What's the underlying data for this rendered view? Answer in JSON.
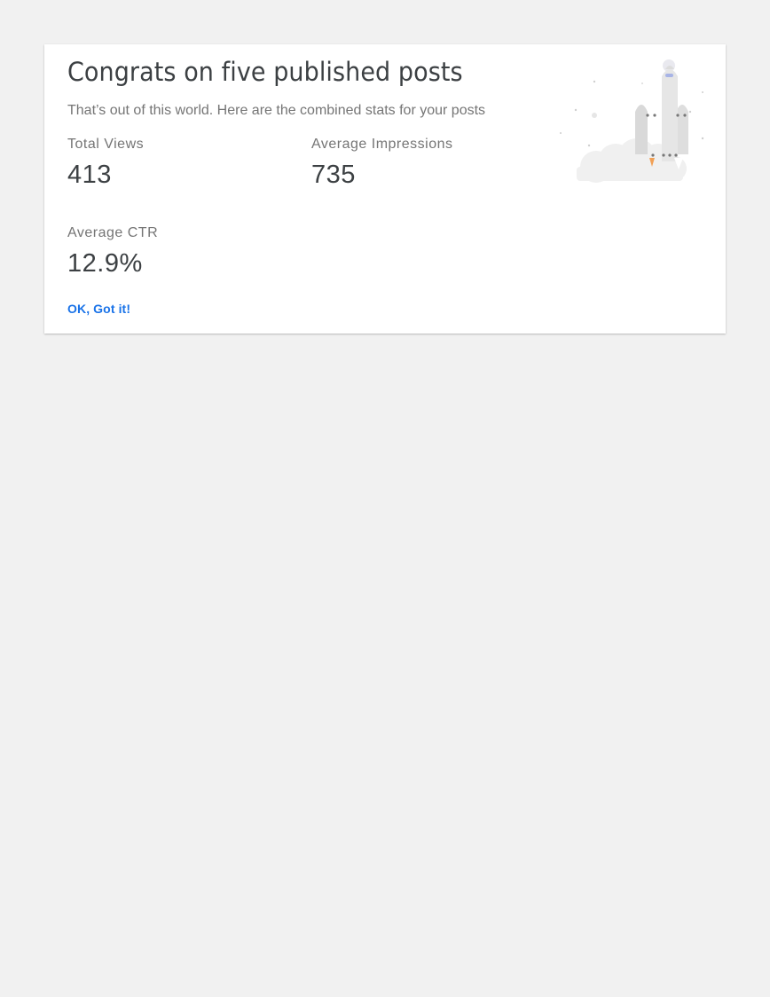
{
  "card": {
    "title": "Congrats on five published posts",
    "subtitle": "That’s out of this world. Here are the combined stats for your posts",
    "illustration_icon": "rocket-launch-icon"
  },
  "stats": {
    "total_views": {
      "label": "Total Views",
      "value": "413"
    },
    "avg_impressions": {
      "label": "Average Impressions",
      "value": "735"
    },
    "avg_ctr": {
      "label": "Average CTR",
      "value": "12.9%"
    }
  },
  "actions": {
    "ok_label": "OK, Got it!"
  },
  "colors": {
    "accent": "#1a73e8",
    "title_text": "#3c4043",
    "secondary_text": "#757575",
    "background": "#f1f1f1",
    "card": "#ffffff"
  }
}
